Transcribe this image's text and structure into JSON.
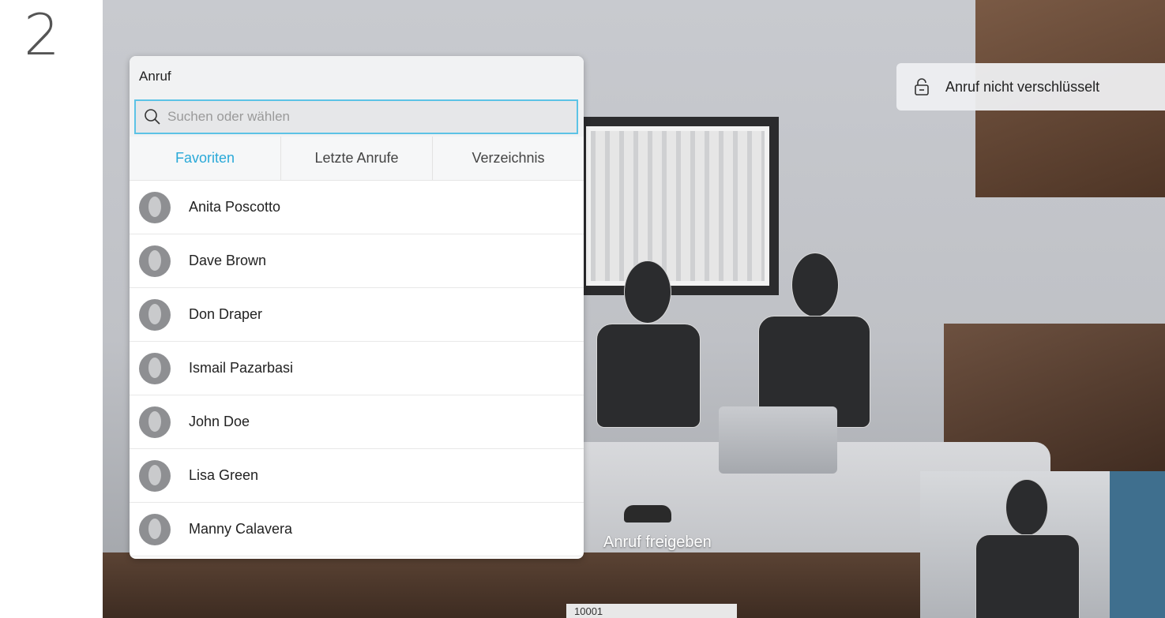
{
  "step": {
    "number": "2"
  },
  "call_panel": {
    "title": "Anruf",
    "search": {
      "placeholder": "Suchen oder wählen"
    },
    "tabs": [
      {
        "label": "Favoriten",
        "active": true
      },
      {
        "label": "Letzte Anrufe",
        "active": false
      },
      {
        "label": "Verzeichnis",
        "active": false
      }
    ],
    "contacts": [
      {
        "name": "Anita Poscotto"
      },
      {
        "name": "Dave Brown"
      },
      {
        "name": "Don Draper"
      },
      {
        "name": "Ismail Pazarbasi"
      },
      {
        "name": "John Doe"
      },
      {
        "name": "Lisa Green"
      },
      {
        "name": "Manny Calavera"
      }
    ]
  },
  "encryption": {
    "label": "Anruf nicht verschlüsselt",
    "icon": "unlocked-icon"
  },
  "share": {
    "label": "Anruf freigeben"
  },
  "number_field": {
    "value": "10001"
  },
  "colors": {
    "accent": "#2aa9d8",
    "search_border": "#5cc3e6"
  }
}
